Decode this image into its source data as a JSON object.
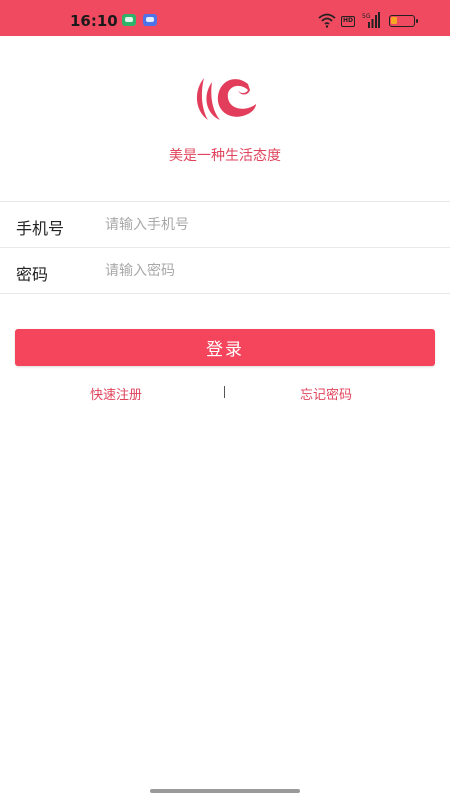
{
  "status_bar": {
    "time": "16:10",
    "network_badge": "HD",
    "signal_label": "5G",
    "battery_level": 0.3,
    "background_color": "#ef4a5f"
  },
  "brand": {
    "logo_icon": "brand-logo-icon",
    "slogan": "美是一种生活态度",
    "accent_color": "#e0445c"
  },
  "form": {
    "phone": {
      "label": "手机号",
      "placeholder": "请输入手机号",
      "value": ""
    },
    "password": {
      "label": "密码",
      "placeholder": "请输入密码",
      "value": ""
    }
  },
  "actions": {
    "login_label": "登录",
    "register_label": "快速注册",
    "separator": "|",
    "forgot_label": "忘记密码"
  }
}
